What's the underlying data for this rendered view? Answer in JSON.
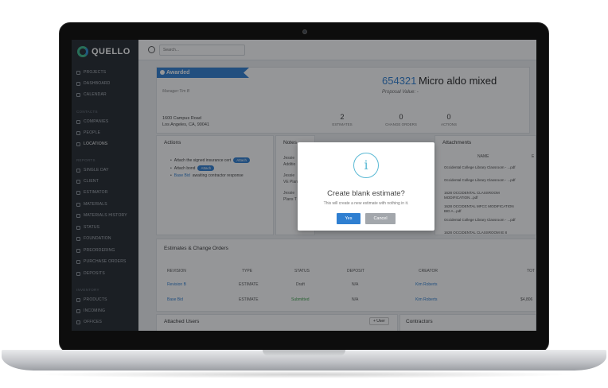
{
  "app": {
    "name": "QUELLO"
  },
  "sidebar": {
    "sections": [
      {
        "label": "",
        "items": [
          "PROJECTS",
          "DASHBOARD",
          "CALENDAR"
        ]
      },
      {
        "label": "CONTACTS",
        "items": [
          "COMPANIES",
          "PEOPLE",
          "LOCATIONS"
        ]
      },
      {
        "label": "REPORTS",
        "items": [
          "SINGLE DAY",
          "CLIENT",
          "ESTIMATOR",
          "MATERIALS",
          "MATERIALS HISTORY",
          "STATUS",
          "FOUNDATION",
          "PREORDERING",
          "PURCHASE ORDERS",
          "DEPOSITS"
        ]
      },
      {
        "label": "INVENTORY",
        "items": [
          "PRODUCTS",
          "INCOMING",
          "OFFICES"
        ]
      }
    ]
  },
  "search": {
    "placeholder": "Search..."
  },
  "project": {
    "status": "Awarded",
    "number": "654321",
    "name": "Micro aldo mixed",
    "proposal": "Proposal Value: -",
    "manager": "Manager:Tim B",
    "address_line1": "1600 Campus Road",
    "address_line2": "Los Angeles, CA, 90041",
    "stats": [
      {
        "value": "2",
        "label": "ESTIMATES"
      },
      {
        "value": "0",
        "label": "CHANGE ORDERS"
      },
      {
        "value": "0",
        "label": "ACTIONS"
      }
    ]
  },
  "actions": {
    "title": "Actions",
    "items": [
      {
        "text": "Attach the signed insurance cert",
        "pill": "Attach"
      },
      {
        "text": "Attach bond",
        "pill": "Attach"
      },
      {
        "link": "Base Bid",
        "text": "awaiting contractor response"
      }
    ]
  },
  "notes": {
    "title": "Notes",
    "lines": [
      "Jessie",
      "Additio",
      "Jessie",
      "VE Plan",
      "Jessie",
      "Plans T"
    ]
  },
  "attachments": {
    "title": "Attachments",
    "col_name": "NAME",
    "col_e": "E",
    "items": [
      "Occidental College Library Classroom - ...pdf",
      "Occidental College Library Classroom - ...pdf",
      "1628 OCCIDENTAL CLASSROOM MODIFICATION...pdf",
      "1628 OCCIDENTAL MFCC MODIFICATION BID A...pdf",
      "Occidental College Library Classroom - ...pdf",
      "1628 OCCIDENTAL CLASSROOM IE 8"
    ]
  },
  "estimates": {
    "title": "Estimates & Change Orders",
    "headers": [
      "REVISION",
      "TYPE",
      "STATUS",
      "DEPOSIT",
      "CREATOR",
      "TOT"
    ],
    "rows": [
      {
        "revision": "Revision B",
        "type": "ESTIMATE",
        "status": "Draft",
        "deposit": "N/A",
        "creator": "Kim Roberts",
        "total": ""
      },
      {
        "revision": "Base Bid",
        "type": "ESTIMATE",
        "status": "Submitted",
        "deposit": "N/A",
        "creator": "Kim Roberts",
        "total": "$4,806"
      }
    ]
  },
  "attached_users": {
    "title": "Attached Users",
    "button": "+ User"
  },
  "contractors": {
    "title": "Contractors"
  },
  "modal": {
    "icon": "i",
    "title": "Create blank estimate?",
    "text": "This will create a new estimate with nothing in it.",
    "yes": "Yes",
    "cancel": "Cancel"
  },
  "colors": {
    "accent": "#2f7fd1",
    "sidebar": "#22272d",
    "success": "#3fa34d",
    "info": "#5ab9d4"
  }
}
